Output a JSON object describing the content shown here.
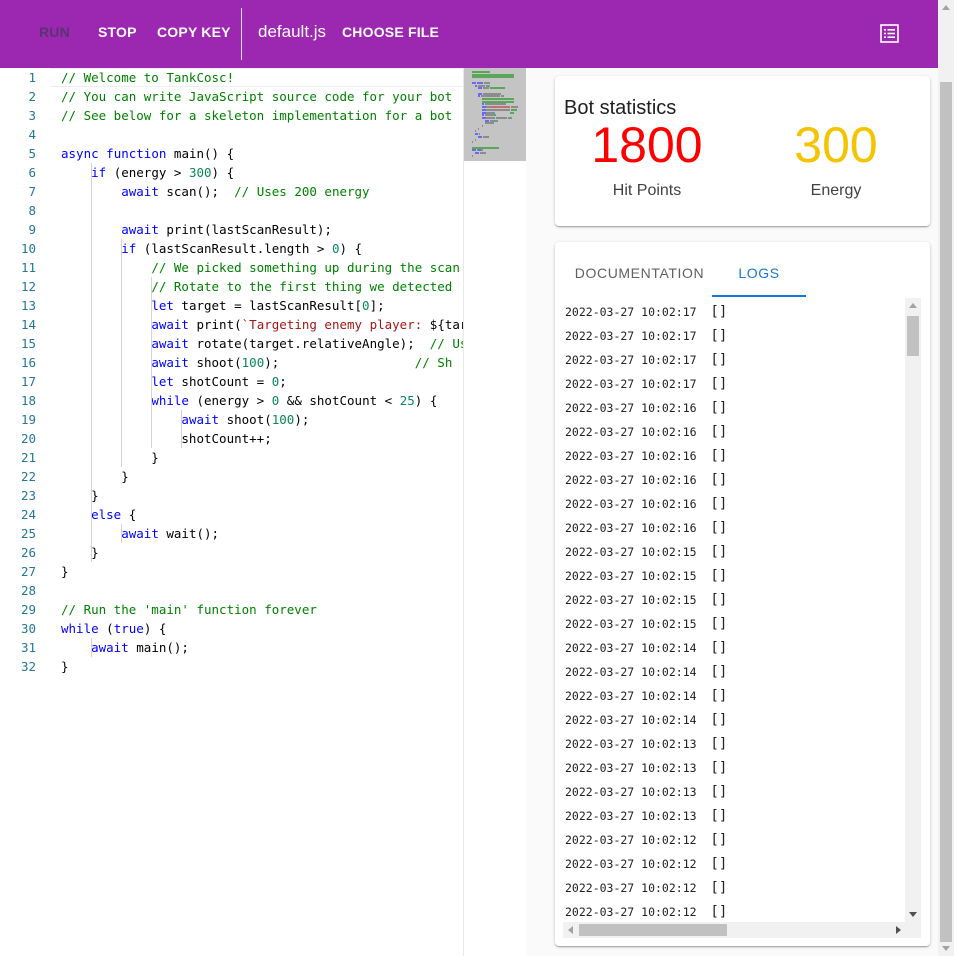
{
  "toolbar": {
    "run_label": "RUN",
    "stop_label": "STOP",
    "copy_key_label": "COPY KEY",
    "file_name": "default.js",
    "choose_file_label": "CHOOSE FILE",
    "menu_icon": "list-icon",
    "accent_color": "#9c27b0"
  },
  "editor": {
    "lines": [
      [
        [
          "// Welcome to TankCosc!",
          "comment"
        ]
      ],
      [
        [
          "// You can write JavaScript source code for your bot",
          "comment"
        ]
      ],
      [
        [
          "// See below for a skeleton implementation for a bot",
          "comment"
        ]
      ],
      [],
      [
        [
          "async",
          "kw"
        ],
        [
          " ",
          ""
        ],
        [
          "function",
          "kw"
        ],
        [
          " main() {",
          ""
        ]
      ],
      [
        [
          "    ",
          ""
        ],
        [
          "if",
          "kw"
        ],
        [
          " (energy > ",
          ""
        ],
        [
          "300",
          "num"
        ],
        [
          ") {",
          ""
        ]
      ],
      [
        [
          "        ",
          ""
        ],
        [
          "await",
          "kw"
        ],
        [
          " scan();  ",
          ""
        ],
        [
          "// Uses 200 energy",
          "comment"
        ]
      ],
      [],
      [
        [
          "        ",
          ""
        ],
        [
          "await",
          "kw"
        ],
        [
          " print(lastScanResult);",
          ""
        ]
      ],
      [
        [
          "        ",
          ""
        ],
        [
          "if",
          "kw"
        ],
        [
          " (lastScanResult.length > ",
          ""
        ],
        [
          "0",
          "num"
        ],
        [
          ") {",
          ""
        ]
      ],
      [
        [
          "            ",
          ""
        ],
        [
          "// We picked something up during the scan",
          "comment"
        ]
      ],
      [
        [
          "            ",
          ""
        ],
        [
          "// Rotate to the first thing we detected",
          "comment"
        ]
      ],
      [
        [
          "            ",
          ""
        ],
        [
          "let",
          "kw"
        ],
        [
          " target = lastScanResult[",
          ""
        ],
        [
          "0",
          "num"
        ],
        [
          "];",
          ""
        ]
      ],
      [
        [
          "            ",
          ""
        ],
        [
          "await",
          "kw"
        ],
        [
          " print(",
          ""
        ],
        [
          "`Targeting enemy player: ",
          "str"
        ],
        [
          "${target",
          ""
        ]
      ],
      [
        [
          "            ",
          ""
        ],
        [
          "await",
          "kw"
        ],
        [
          " rotate(target.relativeAngle);  ",
          ""
        ],
        [
          "// Uses",
          "comment"
        ]
      ],
      [
        [
          "            ",
          ""
        ],
        [
          "await",
          "kw"
        ],
        [
          " shoot(",
          ""
        ],
        [
          "100",
          "num"
        ],
        [
          ");                  ",
          ""
        ],
        [
          "// Sh",
          "comment"
        ]
      ],
      [
        [
          "            ",
          ""
        ],
        [
          "let",
          "kw"
        ],
        [
          " shotCount = ",
          ""
        ],
        [
          "0",
          "num"
        ],
        [
          ";",
          ""
        ]
      ],
      [
        [
          "            ",
          ""
        ],
        [
          "while",
          "kw"
        ],
        [
          " (energy > ",
          ""
        ],
        [
          "0",
          "num"
        ],
        [
          " && shotCount < ",
          ""
        ],
        [
          "25",
          "num"
        ],
        [
          ") {",
          ""
        ]
      ],
      [
        [
          "                ",
          ""
        ],
        [
          "await",
          "kw"
        ],
        [
          " shoot(",
          ""
        ],
        [
          "100",
          "num"
        ],
        [
          ");",
          ""
        ]
      ],
      [
        [
          "                shotCount++;",
          ""
        ]
      ],
      [
        [
          "            }",
          ""
        ]
      ],
      [
        [
          "        }",
          ""
        ]
      ],
      [
        [
          "    }",
          ""
        ]
      ],
      [
        [
          "    ",
          ""
        ],
        [
          "else",
          "kw"
        ],
        [
          " {",
          ""
        ]
      ],
      [
        [
          "        ",
          ""
        ],
        [
          "await",
          "kw"
        ],
        [
          " wait();",
          ""
        ]
      ],
      [
        [
          "    }",
          ""
        ]
      ],
      [
        [
          "}",
          ""
        ]
      ],
      [],
      [
        [
          "// Run the 'main' function forever",
          "comment"
        ]
      ],
      [
        [
          "while",
          "kw"
        ],
        [
          " (",
          ""
        ],
        [
          "true",
          "kw"
        ],
        [
          ") {",
          ""
        ]
      ],
      [
        [
          "    ",
          ""
        ],
        [
          "await",
          "kw"
        ],
        [
          " main();",
          ""
        ]
      ],
      [
        [
          "}",
          ""
        ]
      ]
    ]
  },
  "stats": {
    "title": "Bot statistics",
    "hit_points_value": "1800",
    "hit_points_label": "Hit Points",
    "hit_points_color": "#ff0000",
    "energy_value": "300",
    "energy_label": "Energy",
    "energy_color": "#f5c400"
  },
  "tabs": {
    "documentation_label": "DOCUMENTATION",
    "logs_label": "LOGS",
    "active_color": "#1976d2"
  },
  "logs": [
    {
      "time": "2022-03-27 10:02:17",
      "msg": "[]"
    },
    {
      "time": "2022-03-27 10:02:17",
      "msg": "[]"
    },
    {
      "time": "2022-03-27 10:02:17",
      "msg": "[]"
    },
    {
      "time": "2022-03-27 10:02:17",
      "msg": "[]"
    },
    {
      "time": "2022-03-27 10:02:16",
      "msg": "[]"
    },
    {
      "time": "2022-03-27 10:02:16",
      "msg": "[]"
    },
    {
      "time": "2022-03-27 10:02:16",
      "msg": "[]"
    },
    {
      "time": "2022-03-27 10:02:16",
      "msg": "[]"
    },
    {
      "time": "2022-03-27 10:02:16",
      "msg": "[]"
    },
    {
      "time": "2022-03-27 10:02:16",
      "msg": "[]"
    },
    {
      "time": "2022-03-27 10:02:15",
      "msg": "[]"
    },
    {
      "time": "2022-03-27 10:02:15",
      "msg": "[]"
    },
    {
      "time": "2022-03-27 10:02:15",
      "msg": "[]"
    },
    {
      "time": "2022-03-27 10:02:15",
      "msg": "[]"
    },
    {
      "time": "2022-03-27 10:02:14",
      "msg": "[]"
    },
    {
      "time": "2022-03-27 10:02:14",
      "msg": "[]"
    },
    {
      "time": "2022-03-27 10:02:14",
      "msg": "[]"
    },
    {
      "time": "2022-03-27 10:02:14",
      "msg": "[]"
    },
    {
      "time": "2022-03-27 10:02:13",
      "msg": "[]"
    },
    {
      "time": "2022-03-27 10:02:13",
      "msg": "[]"
    },
    {
      "time": "2022-03-27 10:02:13",
      "msg": "[]"
    },
    {
      "time": "2022-03-27 10:02:13",
      "msg": "[]"
    },
    {
      "time": "2022-03-27 10:02:12",
      "msg": "[]"
    },
    {
      "time": "2022-03-27 10:02:12",
      "msg": "[]"
    },
    {
      "time": "2022-03-27 10:02:12",
      "msg": "[]"
    },
    {
      "time": "2022-03-27 10:02:12",
      "msg": "[]"
    }
  ]
}
